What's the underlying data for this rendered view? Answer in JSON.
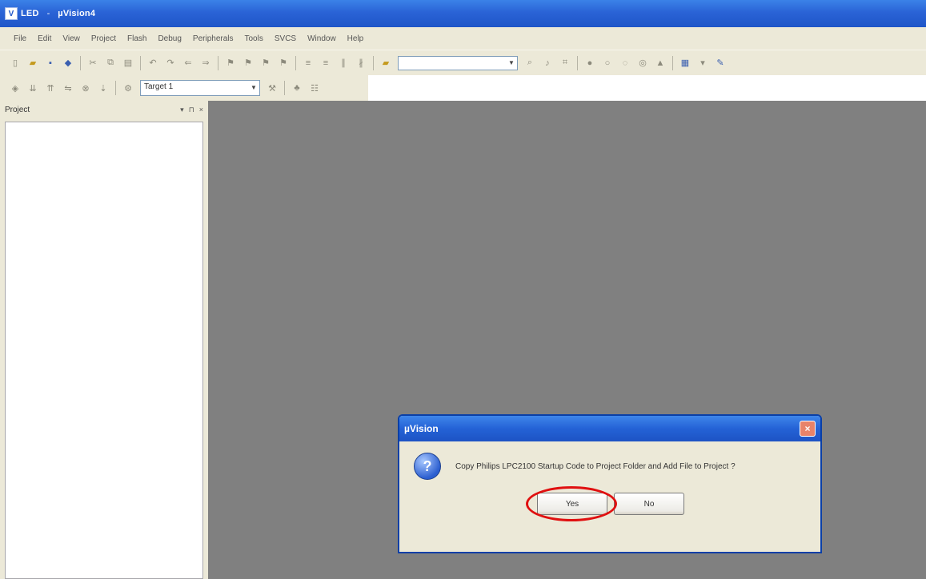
{
  "window": {
    "title_prefix": "LED",
    "title_app": "µVision4",
    "icon_glyph": "V"
  },
  "menu": [
    "File",
    "Edit",
    "View",
    "Project",
    "Flash",
    "Debug",
    "Peripherals",
    "Tools",
    "SVCS",
    "Window",
    "Help"
  ],
  "toolbar": {
    "search_combo_value": "",
    "target_combo_value": "Target 1"
  },
  "project_panel": {
    "title": "Project",
    "pin_glyph": "▾",
    "float_glyph": "⊓",
    "close_glyph": "×"
  },
  "dialog": {
    "title": "µVision",
    "icon_glyph": "?",
    "message": "Copy Philips LPC2100 Startup Code to Project Folder and Add File to Project ?",
    "yes_label": "Yes",
    "no_label": "No",
    "close_glyph": "×"
  },
  "annotation": {
    "highlight_color": "#e01010"
  }
}
